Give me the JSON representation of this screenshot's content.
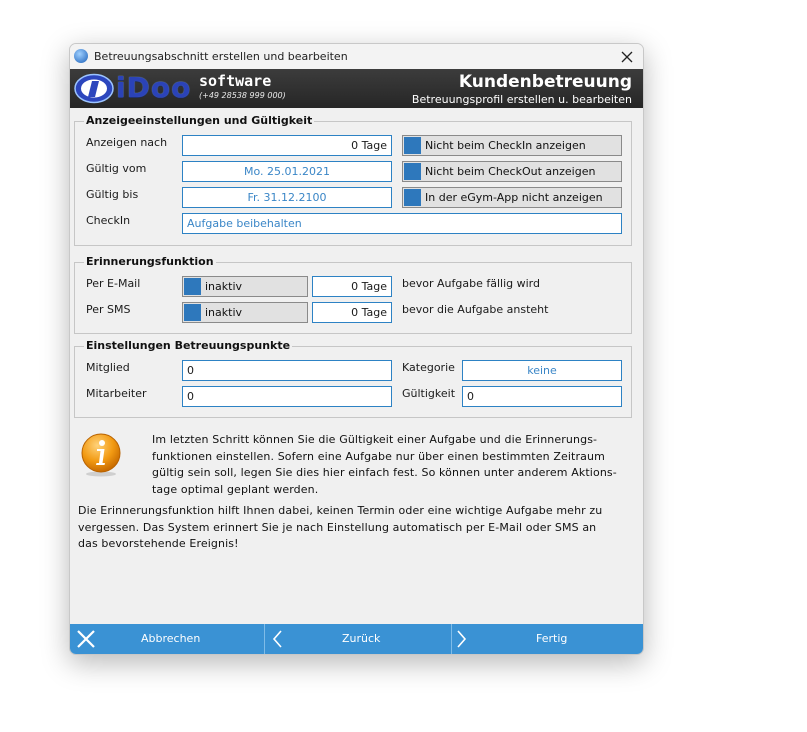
{
  "window": {
    "title": "Betreuungsabschnitt erstellen und bearbeiten"
  },
  "header": {
    "logo_text": "iDoo",
    "logo_software": "software",
    "logo_phone": "(+49 28538 999 000)",
    "title": "Kundenbetreuung",
    "subtitle": "Betreuungsprofil erstellen u. bearbeiten"
  },
  "anzeige": {
    "legend": "Anzeigeeinstellungen und Gültigkeit",
    "anzeigen_label": "Anzeigen nach",
    "anzeigen_value": "0 Tage",
    "gueltig_vom_label": "Gültig vom",
    "gueltig_vom_value": "Mo. 25.01.2021",
    "gueltig_bis_label": "Gültig bis",
    "gueltig_bis_value": "Fr. 31.12.2100",
    "checkin_label": "CheckIn",
    "checkin_value": "Aufgabe beibehalten",
    "opt_checkin": "Nicht beim CheckIn anzeigen",
    "opt_checkout": "Nicht beim CheckOut anzeigen",
    "opt_egym": "In der eGym-App nicht anzeigen"
  },
  "erinnerung": {
    "legend": "Erinnerungsfunktion",
    "email_label": "Per E-Mail",
    "email_status": "inaktiv",
    "email_days": "0 Tage",
    "email_suffix": "bevor Aufgabe fällig wird",
    "sms_label": "Per SMS",
    "sms_status": "inaktiv",
    "sms_days": "0 Tage",
    "sms_suffix": "bevor die Aufgabe ansteht"
  },
  "punkte": {
    "legend": "Einstellungen Betreuungspunkte",
    "mitglied_label": "Mitglied",
    "mitglied_value": "0",
    "mitarbeiter_label": "Mitarbeiter",
    "mitarbeiter_value": "0",
    "kategorie_label": "Kategorie",
    "kategorie_value": "keine",
    "gueltigkeit_label": "Gültigkeit",
    "gueltigkeit_value": "0"
  },
  "info": {
    "line1": "Im letzten Schritt können Sie die Gültigkeit einer Aufgabe und die Erinnerungs-",
    "line2": "funktionen einstellen. Sofern eine Aufgabe nur über einen bestimmten Zeitraum",
    "line3": "gültig sein soll, legen Sie dies hier einfach fest. So können unter anderem Aktions-",
    "line4": "tage optimal geplant werden.",
    "line5": "Die Erinnerungsfunktion hilft Ihnen dabei, keinen Termin oder eine wichtige Aufgabe mehr zu",
    "line6": "vergessen. Das System erinnert Sie je nach Einstellung automatisch per E-Mail oder SMS an",
    "line7": "das bevorstehende Ereignis!"
  },
  "footer": {
    "cancel": "Abbrechen",
    "back": "Zurück",
    "finish": "Fertig"
  },
  "colors": {
    "accent_blue": "#3a92d4",
    "field_border": "#2d82c4",
    "check_blue": "#2e78bc",
    "header_dark": "#2f2f2f"
  }
}
